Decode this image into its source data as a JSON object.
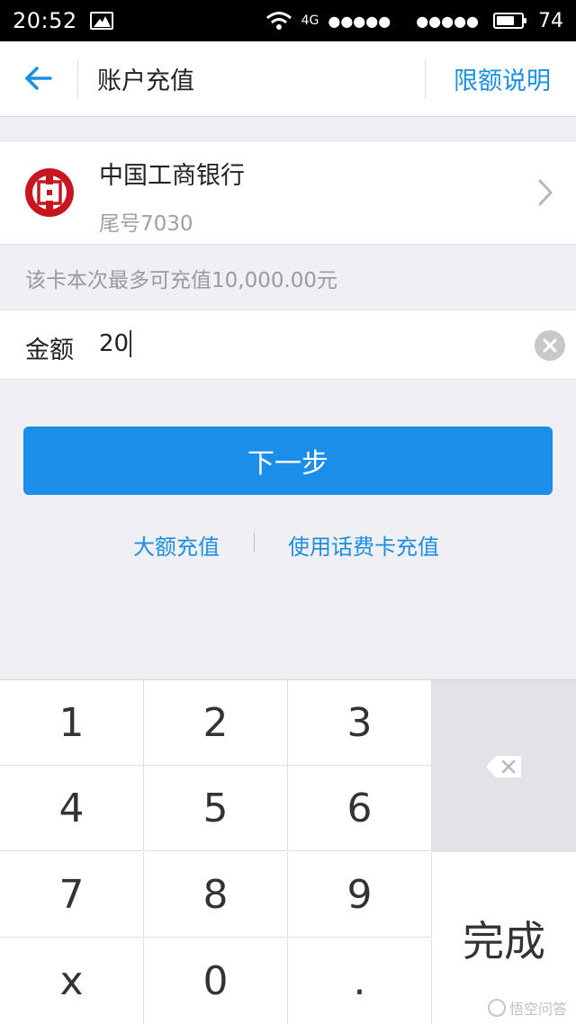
{
  "status_bar": {
    "time": "20:52",
    "network": "4G",
    "signal_dots_left": "●●●●●",
    "signal_dots_right": "●●●●●",
    "battery": "74",
    "battery_level": 0.74
  },
  "header": {
    "title": "账户充值",
    "limit_link": "限额说明"
  },
  "bank": {
    "name": "中国工商银行",
    "tail": "尾号7030",
    "brand_color": "#c7161e"
  },
  "limit_notice": "该卡本次最多可充值10,000.00元",
  "amount": {
    "label": "金额",
    "value": "20"
  },
  "next_button": "下一步",
  "links": {
    "large_recharge": "大额充值",
    "phone_card": "使用话费卡充值"
  },
  "keypad": {
    "keys": [
      "1",
      "2",
      "3",
      "4",
      "5",
      "6",
      "7",
      "8",
      "9",
      "x",
      "0",
      "."
    ],
    "done": "完成"
  },
  "watermark": "悟空问答",
  "colors": {
    "accent": "#1b8eea",
    "link": "#1a8fe0"
  }
}
